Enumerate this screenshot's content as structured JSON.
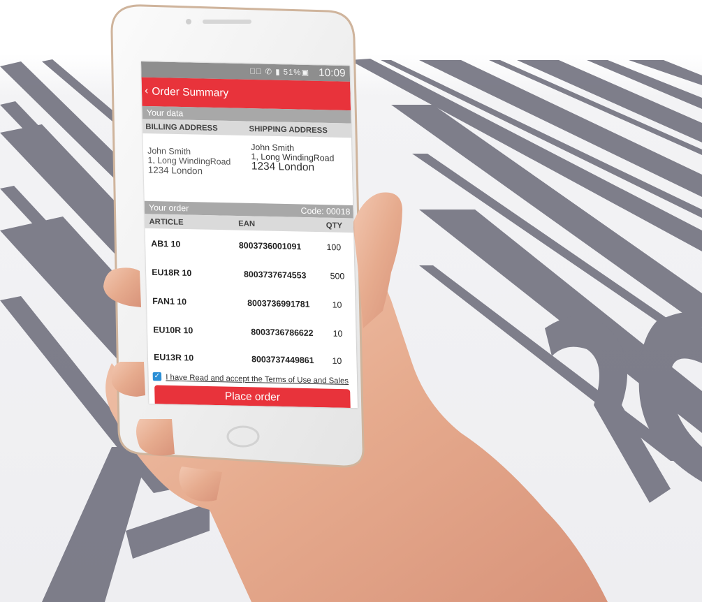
{
  "status_bar": {
    "icons": "◫⃝ ✆ ▮ 51%▣",
    "time": "10:09"
  },
  "app_bar": {
    "back_icon": "chevron-left-icon",
    "title": "Order Summary"
  },
  "your_data": {
    "section_label": "Your data",
    "billing_header": "BILLING ADDRESS",
    "shipping_header": "SHIPPING ADDRESS",
    "billing": {
      "name": "John Smith",
      "street": "1, Long WindingRoad",
      "city": "1234 London"
    },
    "shipping": {
      "name": "John Smith",
      "street": "1, Long WindingRoad",
      "city": "1234 London"
    }
  },
  "order": {
    "section_label": "Your order",
    "code": "Code: 00018",
    "columns": [
      "ARTICLE",
      "EAN",
      "QTY"
    ],
    "rows": [
      {
        "article": "AB1 10",
        "ean": "8003736001091",
        "qty": "100"
      },
      {
        "article": "EU18R 10",
        "ean": "8003737674553",
        "qty": "500"
      },
      {
        "article": "FAN1 10",
        "ean": "8003736991781",
        "qty": "10"
      },
      {
        "article": "EU10R 10",
        "ean": "8003736786622",
        "qty": "10"
      },
      {
        "article": "EU13R 10",
        "ean": "8003737449861",
        "qty": "10"
      }
    ]
  },
  "terms": {
    "checked": true,
    "label": "I have Read and accept the Terms of Use and Sales"
  },
  "place_order_label": "Place order",
  "colors": {
    "accent": "#e8333b",
    "section_header": "#a8a8a8",
    "column_header": "#dadada",
    "checkbox": "#2b8fd6",
    "barcode": "#6a6a78",
    "background": "#f3f3f5"
  }
}
